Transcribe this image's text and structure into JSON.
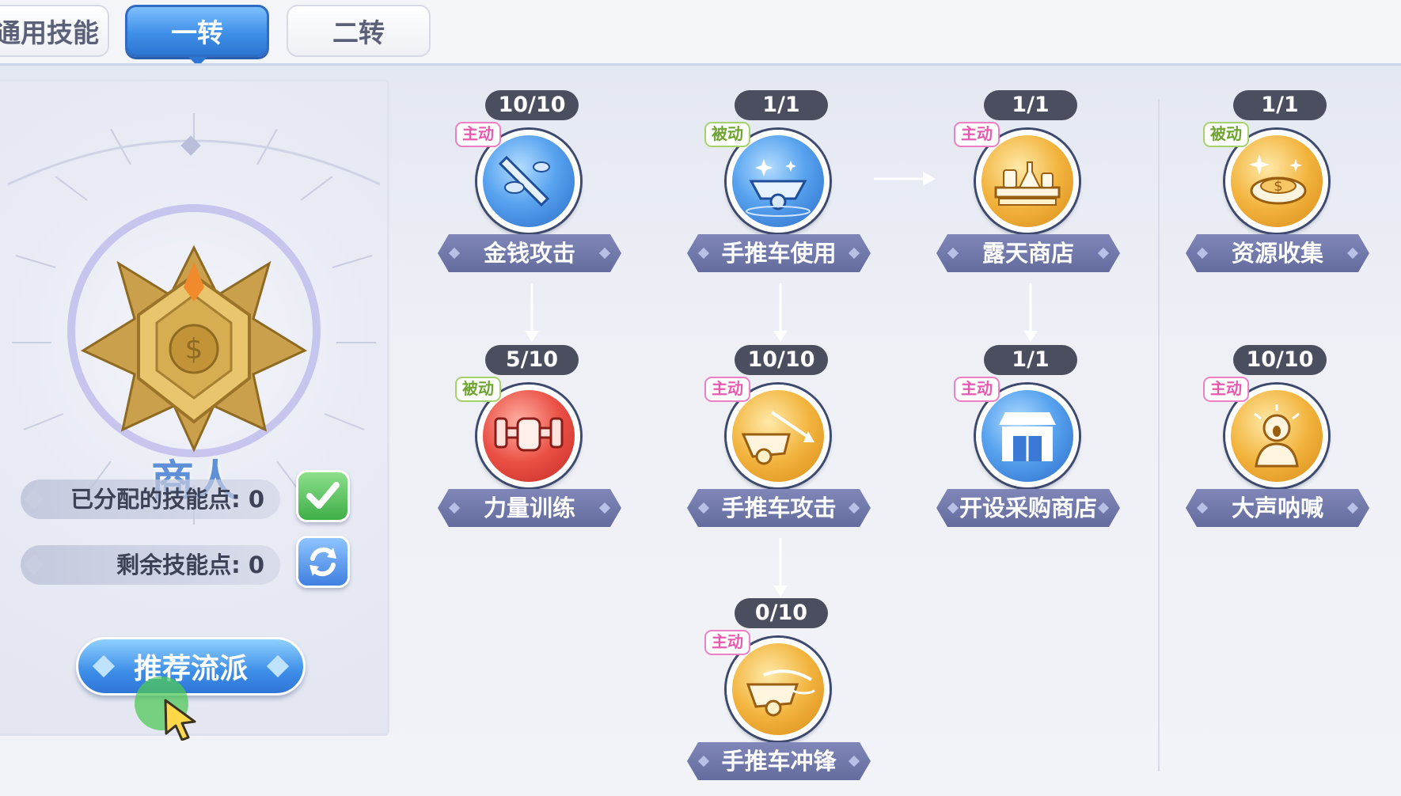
{
  "tabs": {
    "general": "通用技能",
    "first": "一转",
    "second": "二转"
  },
  "class_card": {
    "class_name": "商人",
    "allocated_label": "已分配的技能点",
    "allocated_value": "0",
    "allocated_text": "已分配的技能点: 0",
    "remaining_label": "剩余技能点",
    "remaining_value": "0",
    "remaining_text": "剩余技能点: 0",
    "recommend_label": "推荐流派"
  },
  "colors": {
    "active_tag": "#e75aaf",
    "passive_tag": "#6da530",
    "tab_selected": "#3f8fe8"
  },
  "skills": [
    {
      "level": "10/10",
      "type": "主动",
      "name": "金钱攻击",
      "color": "blue",
      "icon": "sword-coin-icon"
    },
    {
      "level": "5/10",
      "type": "被动",
      "name": "力量训练",
      "color": "red",
      "icon": "fist-dumbbell-icon"
    },
    {
      "level": "1/1",
      "type": "被动",
      "name": "手推车使用",
      "color": "blue",
      "icon": "cart-sparkle-icon"
    },
    {
      "level": "10/10",
      "type": "主动",
      "name": "手推车攻击",
      "color": "gold",
      "icon": "cart-attack-icon"
    },
    {
      "level": "0/10",
      "type": "主动",
      "name": "手推车冲锋",
      "color": "gold",
      "icon": "cart-charge-icon"
    },
    {
      "level": "1/1",
      "type": "主动",
      "name": "露天商店",
      "color": "gold",
      "icon": "stall-icon"
    },
    {
      "level": "1/1",
      "type": "主动",
      "name": "开设采购商店",
      "color": "blue",
      "icon": "shop-icon"
    },
    {
      "level": "1/1",
      "type": "被动",
      "name": "资源收集",
      "color": "gold",
      "icon": "coin-collect-icon"
    },
    {
      "level": "10/10",
      "type": "主动",
      "name": "大声呐喊",
      "color": "gold",
      "icon": "shout-icon"
    }
  ]
}
